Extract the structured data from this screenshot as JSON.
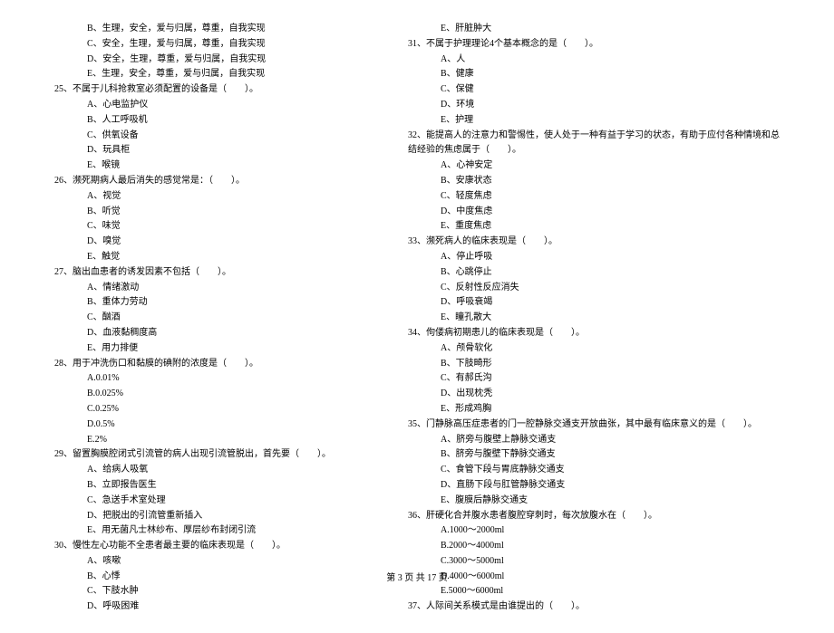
{
  "footer": "第 3 页  共 17 页",
  "left": {
    "pre_opts": [
      "B、生理，安全，爱与归属，尊重，自我实现",
      "C、安全，生理，爱与归属，尊重，自我实现",
      "D、安全，生理，尊重，爱与归属，自我实现",
      "E、生理，安全，尊重，爱与归属，自我实现"
    ],
    "questions": [
      {
        "num": "25",
        "stem": "不属于儿科抢救室必须配置的设备是（　　）。",
        "opts": [
          "A、心电监护仪",
          "B、人工呼吸机",
          "C、供氧设备",
          "D、玩具柜",
          "E、喉镜"
        ]
      },
      {
        "num": "26",
        "stem": "濒死期病人最后消失的感觉常是：（　　）。",
        "opts": [
          "A、视觉",
          "B、听觉",
          "C、味觉",
          "D、嗅觉",
          "E、触觉"
        ]
      },
      {
        "num": "27",
        "stem": "脑出血患者的诱发因素不包括（　　）。",
        "opts": [
          "A、情绪激动",
          "B、重体力劳动",
          "C、酗酒",
          "D、血液黏稠度高",
          "E、用力排便"
        ]
      },
      {
        "num": "28",
        "stem": "用于冲洗伤口和黏膜的碘附的浓度是（　　）。",
        "opts": [
          "A.0.01%",
          "B.0.025%",
          "C.0.25%",
          "D.0.5%",
          "E.2%"
        ]
      },
      {
        "num": "29",
        "stem": "留置胸膜腔闭式引流管的病人出现引流管脱出，首先要（　　）。",
        "opts": [
          "A、给病人吸氧",
          "B、立即报告医生",
          "C、急送手术室处理",
          "D、把脱出的引流管重新插入",
          "E、用无菌凡士林纱布、厚层纱布封闭引流"
        ]
      },
      {
        "num": "30",
        "stem": "慢性左心功能不全患者最主要的临床表现是（　　）。",
        "opts": [
          "A、咳嗽",
          "B、心悸",
          "C、下肢水肿",
          "D、呼吸困难"
        ]
      }
    ]
  },
  "right": {
    "pre_opts": [
      "E、肝脏肿大"
    ],
    "questions": [
      {
        "num": "31",
        "stem": "不属于护理理论4个基本概念的是（　　）。",
        "opts": [
          "A、人",
          "B、健康",
          "C、保健",
          "D、环境",
          "E、护理"
        ]
      },
      {
        "num": "32",
        "stem": "能提高人的注意力和警惕性，使人处于一种有益于学习的状态，有助于应付各种情境和总",
        "cont": "结经验的焦虑属于（　　）。",
        "opts": [
          "A、心神安定",
          "B、安康状态",
          "C、轻度焦虑",
          "D、中度焦虑",
          "E、重度焦虑"
        ]
      },
      {
        "num": "33",
        "stem": "濒死病人的临床表现是（　　）。",
        "opts": [
          "A、停止呼吸",
          "B、心跳停止",
          "C、反射性反应消失",
          "D、呼吸衰竭",
          "E、瞳孔散大"
        ]
      },
      {
        "num": "34",
        "stem": "佝偻病初期患儿的临床表现是（　　）。",
        "opts": [
          "A、颅骨软化",
          "B、下肢畸形",
          "C、有郝氏沟",
          "D、出现枕秃",
          "E、形成鸡胸"
        ]
      },
      {
        "num": "35",
        "stem": "门静脉高压症患者的门一腔静脉交通支开放曲张，其中最有临床意义的是（　　）。",
        "opts": [
          "A、脐旁与腹壁上静脉交通支",
          "B、脐旁与腹壁下静脉交通支",
          "C、食管下段与胃底静脉交通支",
          "D、直肠下段与肛管静脉交通支",
          "E、腹膜后静脉交通支"
        ]
      },
      {
        "num": "36",
        "stem": "肝硬化合并腹水患者腹腔穿刺时，每次放腹水在（　　）。",
        "opts": [
          "A.1000～2000ml",
          "B.2000～4000ml",
          "C.3000～5000ml",
          "D.4000～6000ml",
          "E.5000～6000ml"
        ]
      },
      {
        "num": "37",
        "stem": "人际间关系模式是由谁提出的（　　）。",
        "opts": []
      }
    ]
  }
}
